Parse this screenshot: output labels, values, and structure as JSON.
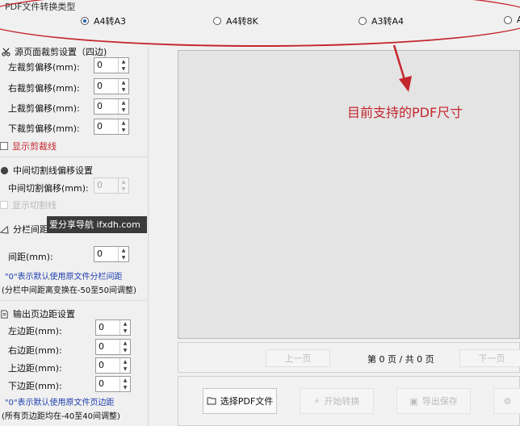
{
  "type_group": {
    "title": "PDF文件转换类型",
    "options": [
      "A4转A3",
      "A4转8K",
      "A3转A4",
      "A"
    ],
    "selected_index": 0
  },
  "crop": {
    "title": "源页面裁剪设置（四边)",
    "fields": [
      {
        "label": "左裁剪偏移(mm):",
        "value": "0"
      },
      {
        "label": "右裁剪偏移(mm):",
        "value": "0"
      },
      {
        "label": "上裁剪偏移(mm):",
        "value": "0"
      },
      {
        "label": "下裁剪偏移(mm):",
        "value": "0"
      }
    ],
    "show_lines": "显示剪裁线"
  },
  "middle": {
    "title": "中间切割线偏移设置",
    "label": "中间切割偏移(mm):",
    "value": "0",
    "show_lines": "显示切割线"
  },
  "columns": {
    "title": "分栏间距",
    "label": "间距(mm):",
    "value": "0",
    "note1": "\"0\"表示默认使用原文件分栏间距",
    "note2": "(分栏中间距离变换在-50至50间调整)"
  },
  "margins": {
    "title": "输出页边距设置",
    "fields": [
      {
        "label": "左边距(mm):",
        "value": "0"
      },
      {
        "label": "右边距(mm):",
        "value": "0"
      },
      {
        "label": "上边距(mm):",
        "value": "0"
      },
      {
        "label": "下边距(mm):",
        "value": "0"
      }
    ],
    "note1": "\"0\"表示默认使用原文件页边距",
    "note2": "(所有页边距均在-40至40间调整)"
  },
  "pager": {
    "prev": "上一页",
    "info": "第 0 页 / 共 0 页",
    "next": "下一页"
  },
  "actions": {
    "select": "选择PDF文件",
    "start": "开始转换",
    "save": "导出保存"
  },
  "watermark": "爱分享导航 ifxdh.com",
  "annotation": "目前支持的PDF尺寸",
  "colors": {
    "annotation_red": "#c4262e",
    "note_blue": "#1f3fae",
    "radio_blue": "#1a5fb4"
  }
}
